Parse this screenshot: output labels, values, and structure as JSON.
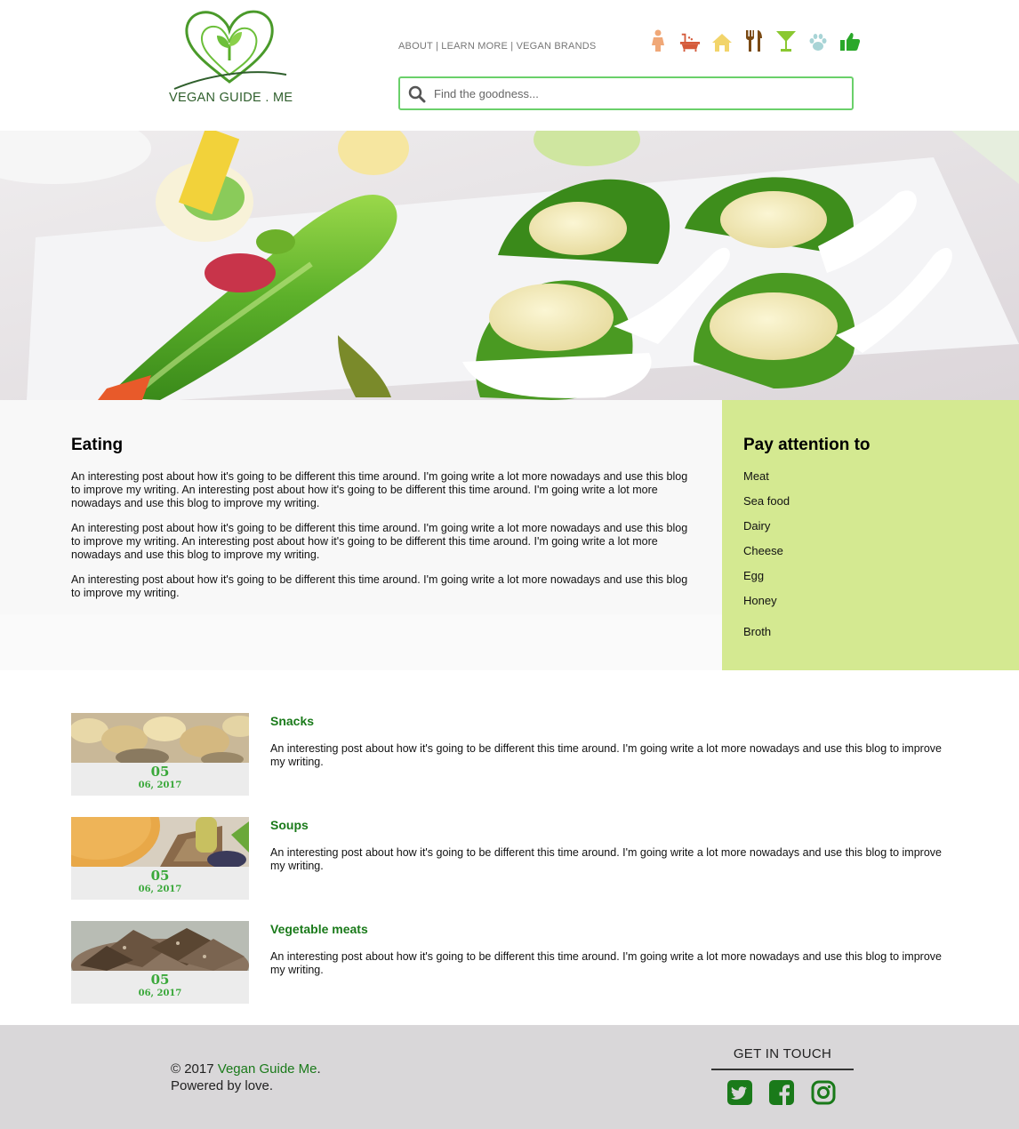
{
  "header": {
    "logo_text": "VEGAN GUIDE . ME",
    "nav": [
      "ABOUT",
      "LEARN MORE",
      "VEGAN BRANDS"
    ],
    "nav_sep": " | ",
    "category_icons": [
      "person-icon",
      "bathtub-icon",
      "home-icon",
      "utensils-icon",
      "cocktail-icon",
      "paw-icon",
      "thumbs-up-icon"
    ],
    "search_placeholder": "Find the goodness..."
  },
  "main": {
    "title": "Eating",
    "paragraphs": [
      "An interesting post about how it's going to be different this time around. I'm going write a lot more nowadays and use this blog to improve my writing. An interesting post about how it's going to be different this time around. I'm going write a lot more nowadays and use this blog to improve my writing.",
      "An interesting post about how it's going to be different this time around. I'm going write a lot more nowadays and use this blog to improve my writing. An interesting post about how it's going to be different this time around. I'm going write a lot more nowadays and use this blog to improve my writing.",
      "An interesting post about how it's going to be different this time around. I'm going write a lot more nowadays and use this blog to improve my writing."
    ]
  },
  "sidebar": {
    "title": "Pay attention to",
    "items": [
      "Meat",
      "Sea food",
      "Dairy",
      "Cheese",
      "Egg",
      "Honey",
      "Broth"
    ]
  },
  "posts": [
    {
      "title": "Snacks",
      "day": "05",
      "date": "06, 2017",
      "text": "An interesting post about how it's going to be different this time around. I'm going write a lot more nowadays and use this blog to improve my writing."
    },
    {
      "title": "Soups",
      "day": "05",
      "date": "06, 2017",
      "text": "An interesting post about how it's going to be different this time around. I'm going write a lot more nowadays and use this blog to improve my writing."
    },
    {
      "title": "Vegetable meats",
      "day": "05",
      "date": "06, 2017",
      "text": "An interesting post about how it's going to be different this time around. I'm going write a lot more nowadays and use this blog to improve my writing."
    }
  ],
  "footer": {
    "copyright_prefix": "© 2017 ",
    "site_name": "Vegan Guide Me",
    "copyright_suffix": ".",
    "powered": "Powered by love.",
    "get_in_touch": "GET IN TOUCH",
    "social": [
      "twitter-icon",
      "facebook-icon",
      "instagram-icon"
    ]
  },
  "colors": {
    "accent_green": "#1a7a1a",
    "search_border": "#6ad06a",
    "sidebar_bg": "#d4e991",
    "footer_bg": "#d9d7d9"
  }
}
